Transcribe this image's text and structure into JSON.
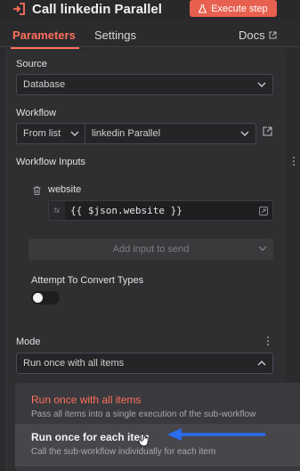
{
  "header": {
    "title": "Call linkedin Parallel",
    "execute_label": "Execute step",
    "colors": {
      "accent": "#ff6f5c",
      "execute_bg": "#e8604f"
    }
  },
  "tabs": [
    {
      "label": "Parameters",
      "active": true
    },
    {
      "label": "Settings",
      "active": false
    },
    {
      "label": "Docs",
      "active": false
    }
  ],
  "source": {
    "label": "Source",
    "value": "Database"
  },
  "workflow": {
    "label": "Workflow",
    "mode": "From list",
    "value": "linkedin Parallel"
  },
  "workflow_inputs": {
    "label": "Workflow Inputs",
    "field_name": "website",
    "fx_label": "fx",
    "expression": "{{ $json.website }}",
    "add_placeholder": "Add input to send"
  },
  "convert_types": {
    "label": "Attempt To Convert Types",
    "enabled": false
  },
  "mode": {
    "label": "Mode",
    "value": "Run once with all items",
    "options": [
      {
        "title": "Run once with all items",
        "description": "Pass all items into a single execution of the sub-workflow",
        "selected": true
      },
      {
        "title": "Run once for each item",
        "description": "Call the sub-workflow individually for each item",
        "hovered": true
      }
    ]
  }
}
